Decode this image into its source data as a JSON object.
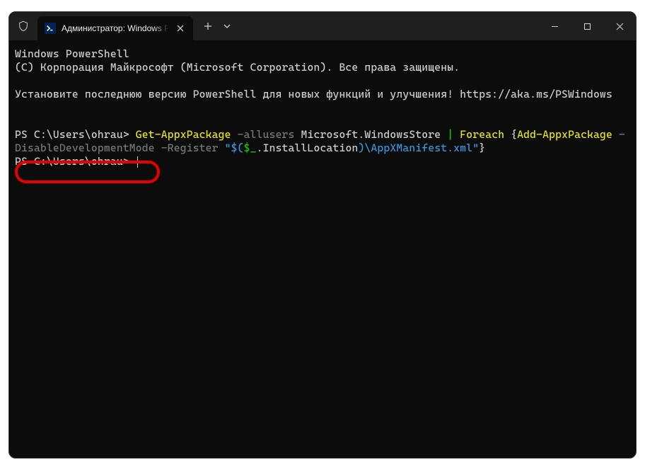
{
  "titlebar": {
    "tab_title": "Администратор: Windows PowerShell"
  },
  "terminal": {
    "line_header": "Windows PowerShell",
    "line_copyright": "(C) Корпорация Майкрософт (Microsoft Corporation). Все права защищены.",
    "line_notice": "Установите последнюю версию PowerShell для новых функций и улучшения! https://aka.ms/PSWindows",
    "prompt1": "PS C:\\Users\\ohrau> ",
    "cmd": {
      "p1": "Get-AppxPackage",
      "p2": " -allusers",
      "p3": " Microsoft.WindowsStore ",
      "p4": "|",
      "p5": " Foreach",
      "p6": " {",
      "p7": "Add-AppxPackage",
      "p8": " -DisableDevelopmentMode",
      "p9": " -Register",
      "p10": " \"$(",
      "p11": "$_",
      "p12": ".InstallLocation",
      "p13": ")",
      "p14": "\\AppXManifest.xml",
      "p15": "\"",
      "p16": "}"
    },
    "prompt2": "PS C:\\Users\\ohrau> "
  }
}
